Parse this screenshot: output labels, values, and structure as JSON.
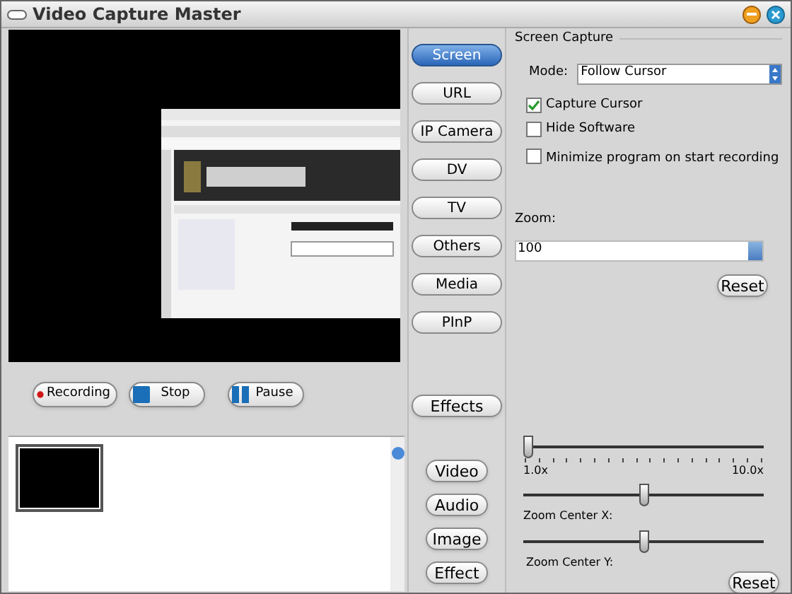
{
  "window": {
    "title": "Video Capture Master"
  },
  "preview": {
    "kind": "picture"
  },
  "controls": [
    "Recording",
    "Stop",
    "Pause"
  ],
  "sources": [
    {
      "label": "Screen",
      "selected": true
    },
    {
      "label": "URL",
      "selected": false
    },
    {
      "label": "IP Camera",
      "selected": false
    },
    {
      "label": "DV",
      "selected": false
    },
    {
      "label": "TV",
      "selected": false
    },
    {
      "label": "Others",
      "selected": false
    },
    {
      "label": "Media",
      "selected": false
    },
    {
      "label": "PInP",
      "selected": false
    }
  ],
  "effects_button": "Effects",
  "screen_capture": {
    "title": "Screen Capture",
    "mode_label": "Mode:",
    "mode_value": "Follow Cursor",
    "options": [
      {
        "label": "Capture Cursor",
        "checked": true
      },
      {
        "label": "Hide Software",
        "checked": false
      },
      {
        "label": "Minimize program on start recording",
        "checked": false
      }
    ],
    "zoom_label": "Zoom:",
    "zoom_value": "100",
    "reset": "Reset"
  },
  "output_buttons": [
    "Video",
    "Audio",
    "Image",
    "Effect"
  ],
  "zoom_slider": {
    "level": 0,
    "min_label": "1.0x",
    "max_label": "10.0x"
  },
  "center_x": {
    "label": "Zoom Center X:",
    "level": 0.5
  },
  "center_y": {
    "label": "Zoom Center Y:",
    "level": 0.5
  },
  "reset_button": "Reset"
}
